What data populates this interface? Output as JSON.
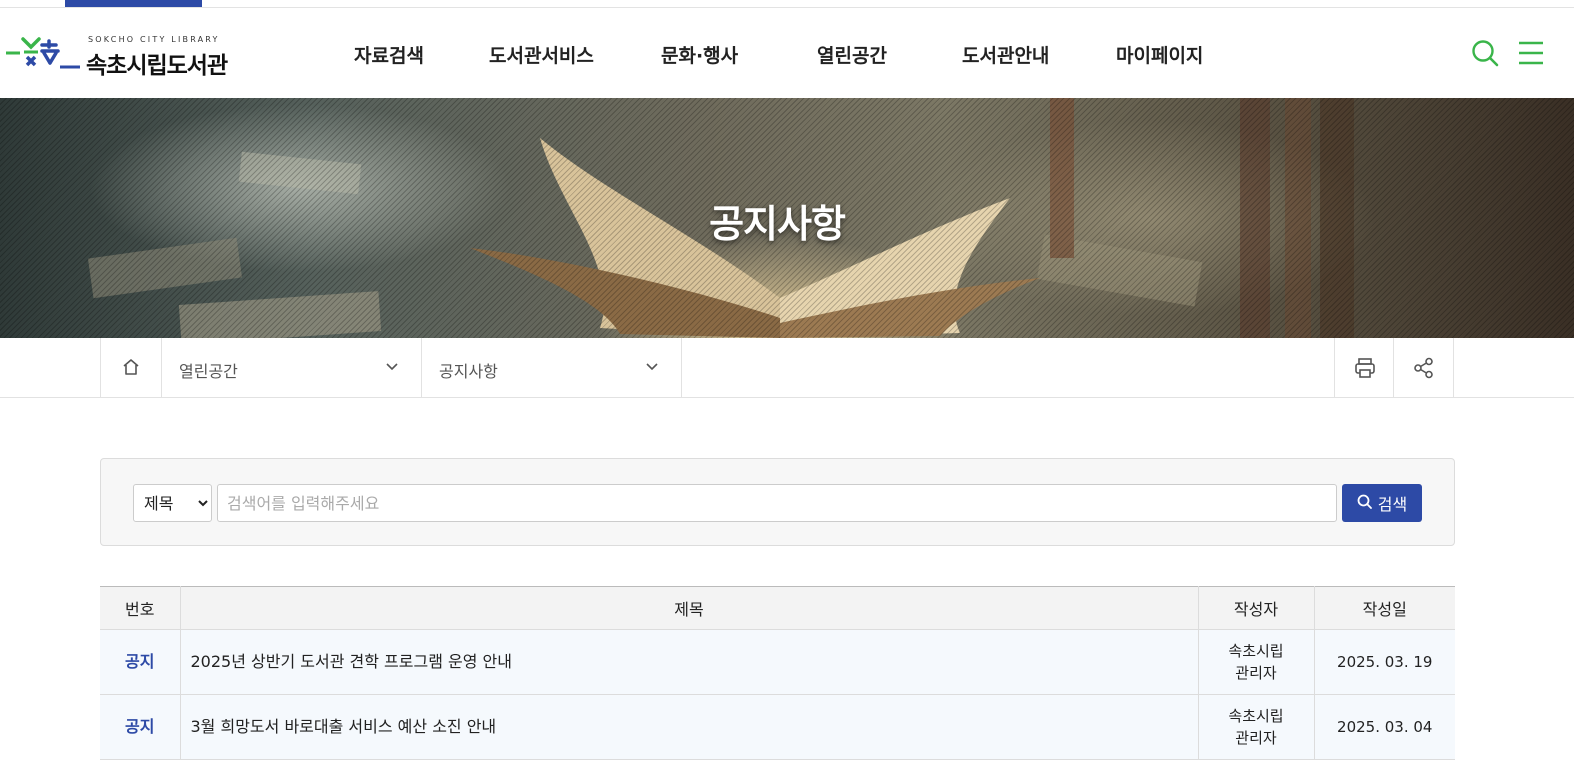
{
  "logo": {
    "subtitle": "SOKCHO CITY LIBRARY",
    "name": "속초시립도서관"
  },
  "nav": {
    "items": [
      {
        "label": "자료검색"
      },
      {
        "label": "도서관서비스"
      },
      {
        "label": "문화·행사"
      },
      {
        "label": "열린공간"
      },
      {
        "label": "도서관안내"
      },
      {
        "label": "마이페이지"
      }
    ]
  },
  "header_icons": [
    "search-icon",
    "menu-icon"
  ],
  "hero": {
    "title": "공지사항"
  },
  "location": {
    "home_icon": "home-icon",
    "depth1": "열린공간",
    "depth2": "공지사항",
    "tools": [
      "print-icon",
      "share-icon"
    ]
  },
  "search": {
    "field_options": [
      "제목"
    ],
    "selected_field": "제목",
    "placeholder": "검색어를 입력해주세요",
    "value": "",
    "button_label": "검색"
  },
  "table": {
    "columns": [
      "번호",
      "제목",
      "작성자",
      "작성일"
    ],
    "rows": [
      {
        "number": "공지",
        "title": "2025년 상반기 도서관 견학 프로그램 운영 안내",
        "author_line1": "속초시립",
        "author_line2": "관리자",
        "date": "2025. 03. 19"
      },
      {
        "number": "공지",
        "title": "3월 희망도서 바로대출 서비스 예산 소진 안내",
        "author_line1": "속초시립",
        "author_line2": "관리자",
        "date": "2025. 03. 04"
      }
    ]
  },
  "colors": {
    "brand_blue": "#2d4aa6",
    "brand_green": "#3ab54a",
    "notice_text": "#2d4aa6",
    "row_bg": "#f5f9fd"
  }
}
